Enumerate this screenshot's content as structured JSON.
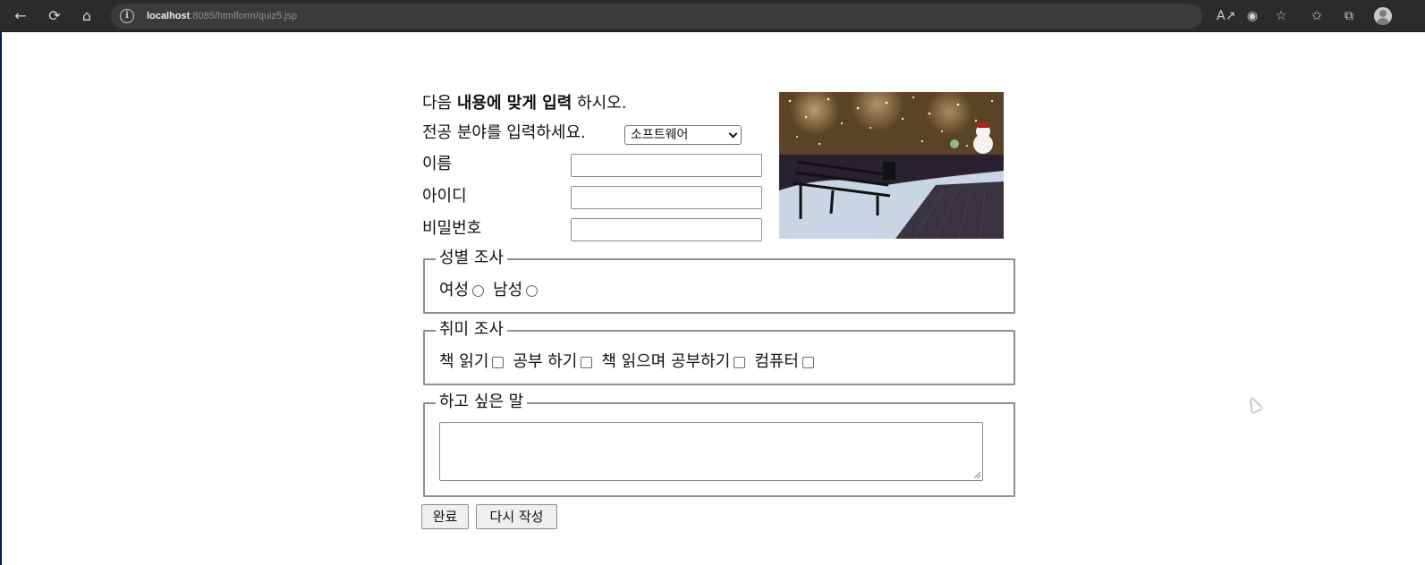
{
  "browser": {
    "url_host": "localhost",
    "url_path": ":8085/htmlform/quiz5.jsp",
    "icons": [
      "back-icon",
      "reload-icon",
      "home-icon",
      "info-icon",
      "read-aloud-icon",
      "reader-icon",
      "favorites-add-icon",
      "favorites-icon",
      "collections-icon",
      "profile-icon"
    ]
  },
  "form": {
    "instruction_prefix": "다음 ",
    "instruction_bold": "내용에 맞게 입력",
    "instruction_suffix": " 하시오.",
    "major_label": "전공 분야를 입력하세요.",
    "major_selected": "소프트웨어",
    "name_label": "이름",
    "id_label": "아이디",
    "password_label": "비밀번호",
    "gender": {
      "legend": "성별 조사",
      "options": [
        "여성",
        "남성"
      ]
    },
    "hobby": {
      "legend": "취미 조사",
      "options": [
        "책 읽기",
        "공부 하기",
        "책 읽으며 공부하기",
        "컴퓨터"
      ]
    },
    "message": {
      "legend": "하고 싶은 말"
    },
    "submit_label": "완료",
    "reset_label": "다시 작성"
  },
  "colors": {
    "browser_toolbar": "#2b2b2b",
    "fieldset_border": "#8f8f8f",
    "button_bg": "#efefef"
  }
}
